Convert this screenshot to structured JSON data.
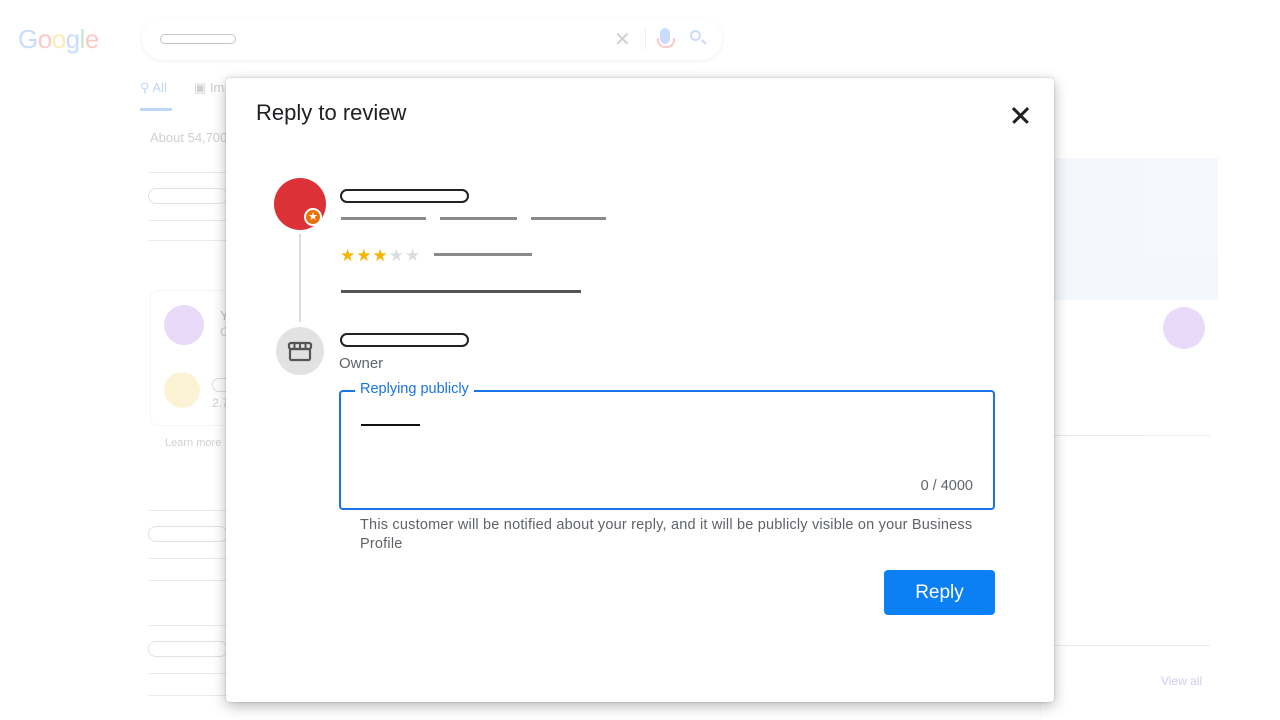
{
  "background": {
    "logo": {
      "letters": [
        "G",
        "o",
        "o",
        "g",
        "l",
        "e"
      ],
      "colors": [
        "#4285f4",
        "#ea4335",
        "#fbbc05",
        "#4285f4",
        "#34a853",
        "#ea4335"
      ]
    },
    "search": {
      "clear_icon": "close-icon",
      "mic_icon": "mic-icon",
      "search_icon": "search-icon"
    },
    "tabs": [
      {
        "label": "All",
        "icon": "search-icon"
      },
      {
        "label": "Im",
        "icon": "image-icon"
      }
    ],
    "results_count": "About 54,700",
    "left_card": {
      "item1_initial": "Y",
      "item1_sub": "C",
      "item2_sub": "2.7"
    },
    "learn_more": "Learn more",
    "view_all": "View all"
  },
  "dialog": {
    "title": "Reply to review",
    "close_icon": "close-icon",
    "review": {
      "avatar_color": "#dd3138",
      "badge_icon": "local-guide-star-icon",
      "rating": 3,
      "max_rating": 5,
      "stars": [
        "★",
        "★",
        "★",
        "★",
        "★"
      ]
    },
    "owner": {
      "avatar_icon": "storefront-icon",
      "role": "Owner"
    },
    "reply_field": {
      "label": "Replying publicly",
      "value": "",
      "counter": "0 / 4000"
    },
    "notice": "This customer will be notified about your reply, and it will be publicly visible on your Business Profile",
    "reply_button": "Reply",
    "accent_color": "#1a73e8"
  }
}
